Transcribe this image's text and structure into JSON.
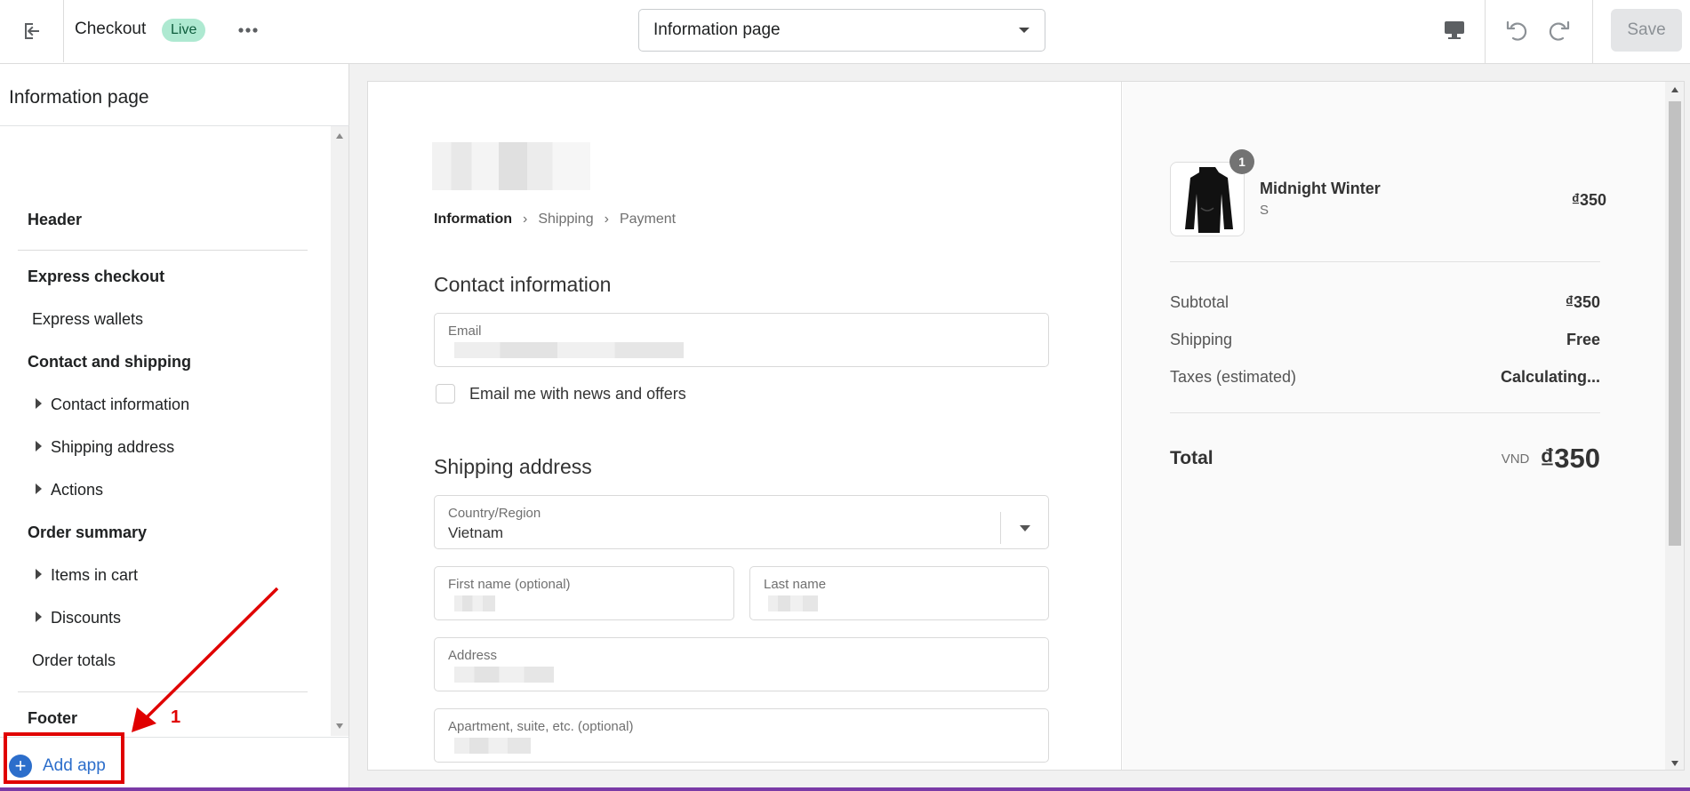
{
  "topbar": {
    "app_title": "Checkout",
    "live_badge": "Live",
    "page_select": "Information page",
    "save_label": "Save"
  },
  "sidebar": {
    "title": "Information page",
    "items": [
      {
        "label": "Header",
        "kind": "section"
      },
      {
        "label": "Express checkout",
        "kind": "section"
      },
      {
        "label": "Express wallets",
        "kind": "item"
      },
      {
        "label": "Contact and shipping",
        "kind": "section"
      },
      {
        "label": "Contact information",
        "kind": "expandable"
      },
      {
        "label": "Shipping address",
        "kind": "expandable"
      },
      {
        "label": "Actions",
        "kind": "expandable"
      },
      {
        "label": "Order summary",
        "kind": "section"
      },
      {
        "label": "Items in cart",
        "kind": "expandable"
      },
      {
        "label": "Discounts",
        "kind": "expandable"
      },
      {
        "label": "Order totals",
        "kind": "item"
      },
      {
        "label": "Footer",
        "kind": "section"
      }
    ],
    "add_app_label": "Add app",
    "annotation_number": "1"
  },
  "preview": {
    "breadcrumbs": [
      "Information",
      "Shipping",
      "Payment"
    ],
    "contact_heading": "Contact information",
    "email_label": "Email",
    "newsletter_label": "Email me with news and offers",
    "shipping_heading": "Shipping address",
    "country_label": "Country/Region",
    "country_value": "Vietnam",
    "first_name_label": "First name (optional)",
    "last_name_label": "Last name",
    "address_label": "Address",
    "apartment_label": "Apartment, suite, etc. (optional)"
  },
  "summary": {
    "product_name": "Midnight Winter",
    "product_variant": "S",
    "product_qty": "1",
    "product_price": "₫350",
    "subtotal_label": "Subtotal",
    "subtotal_value": "₫350",
    "shipping_label": "Shipping",
    "shipping_value": "Free",
    "taxes_label": "Taxes (estimated)",
    "taxes_value": "Calculating...",
    "total_label": "Total",
    "currency_code": "VND",
    "total_value": "₫350"
  },
  "colors": {
    "accent": "#2c6ecb",
    "live_badge_bg": "#aee9d1",
    "annotation": "#e00000"
  }
}
